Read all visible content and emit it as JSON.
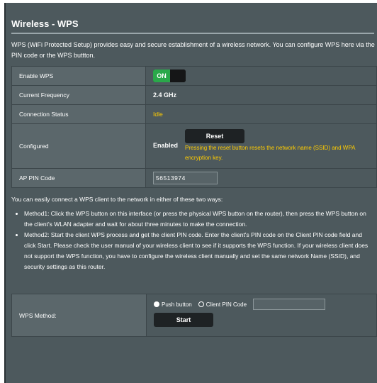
{
  "page": {
    "title": "Wireless - WPS",
    "description": "WPS (WiFi Protected Setup) provides easy and secure establishment of a wireless network. You can configure WPS here via the PIN code or the WPS buttton."
  },
  "settings": {
    "enable_wps": {
      "label": "Enable WPS",
      "toggle_text": "ON",
      "state": "on"
    },
    "current_frequency": {
      "label": "Current Frequency",
      "value": "2.4 GHz"
    },
    "connection_status": {
      "label": "Connection Status",
      "value": "Idle"
    },
    "configured": {
      "label": "Configured",
      "value": "Enabled",
      "reset_label": "Reset",
      "note": "Pressing the reset button resets the network name (SSID) and WPA encryption key."
    },
    "ap_pin": {
      "label": "AP PIN Code",
      "value": "56513974"
    }
  },
  "info": {
    "intro": "You can easily connect a WPS client to the network in either of these two ways:",
    "methods": [
      "Method1: Click the WPS button on this interface (or press the physical WPS button on the router), then press the WPS button on the client's WLAN adapter and wait for about three minutes to make the connection.",
      "Method2: Start the client WPS process and get the client PIN code. Enter the client's PIN code on the Client PIN code field and click Start. Please check the user manual of your wireless client to see if it supports the WPS function. If your wireless client does not support the WPS function, you have to configure the wireless client manually and set the same network Name (SSID), and security settings as this router."
    ]
  },
  "wps_method": {
    "label": "WPS Method:",
    "options": [
      "Push button",
      "Client PIN Code"
    ],
    "selected": "Push button",
    "client_pin_value": "",
    "start_label": "Start"
  },
  "colors": {
    "panel_bg": "#4d595d",
    "label_bg": "#5b676b",
    "toggle_on": "#2aa84a",
    "status_accent": "#ffcc00",
    "button_bg": "#1e2224"
  }
}
